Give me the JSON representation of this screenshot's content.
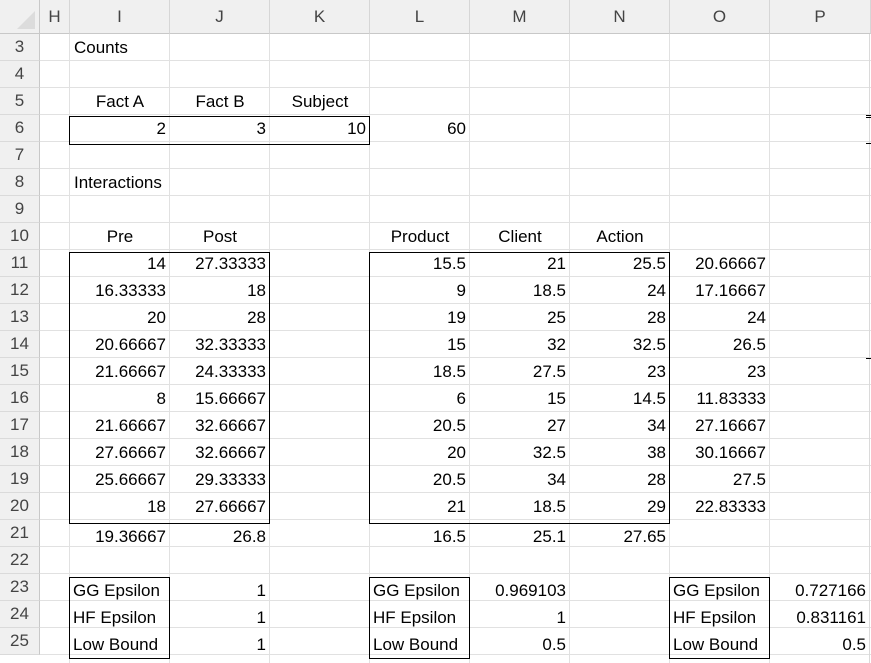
{
  "columns": [
    "H",
    "I",
    "J",
    "K",
    "L",
    "M",
    "N",
    "O",
    "P"
  ],
  "rows": [
    "3",
    "4",
    "5",
    "6",
    "7",
    "8",
    "9",
    "10",
    "11",
    "12",
    "13",
    "14",
    "15",
    "16",
    "17",
    "18",
    "19",
    "20",
    "21",
    "22",
    "23",
    "24",
    "25"
  ],
  "counts": {
    "title": "Counts",
    "headers": [
      "Fact A",
      "Fact B",
      "Subject"
    ],
    "values": [
      "2",
      "3",
      "10"
    ],
    "total": "60"
  },
  "interactions": {
    "title": "Interactions",
    "left_headers": [
      "Pre",
      "Post"
    ],
    "left_rows": [
      [
        "14",
        "27.33333"
      ],
      [
        "16.33333",
        "18"
      ],
      [
        "20",
        "28"
      ],
      [
        "20.66667",
        "32.33333"
      ],
      [
        "21.66667",
        "24.33333"
      ],
      [
        "8",
        "15.66667"
      ],
      [
        "21.66667",
        "32.66667"
      ],
      [
        "27.66667",
        "32.66667"
      ],
      [
        "25.66667",
        "29.33333"
      ],
      [
        "18",
        "27.66667"
      ]
    ],
    "left_means": [
      "19.36667",
      "26.8"
    ],
    "right_headers": [
      "Product",
      "Client",
      "Action"
    ],
    "right_rows": [
      [
        "15.5",
        "21",
        "25.5",
        "20.66667"
      ],
      [
        "9",
        "18.5",
        "24",
        "17.16667"
      ],
      [
        "19",
        "25",
        "28",
        "24"
      ],
      [
        "15",
        "32",
        "32.5",
        "26.5"
      ],
      [
        "18.5",
        "27.5",
        "23",
        "23"
      ],
      [
        "6",
        "15",
        "14.5",
        "11.83333"
      ],
      [
        "20.5",
        "27",
        "34",
        "27.16667"
      ],
      [
        "20",
        "32.5",
        "38",
        "30.16667"
      ],
      [
        "20.5",
        "34",
        "28",
        "27.5"
      ],
      [
        "21",
        "18.5",
        "29",
        "22.83333"
      ]
    ],
    "right_means": [
      "16.5",
      "25.1",
      "27.65"
    ]
  },
  "epsilon_tables": [
    {
      "labels": [
        "GG Epsilon",
        "HF Epsilon",
        "Low Bound"
      ],
      "values": [
        "1",
        "1",
        "1"
      ]
    },
    {
      "labels": [
        "GG Epsilon",
        "HF Epsilon",
        "Low Bound"
      ],
      "values": [
        "0.969103",
        "1",
        "0.5"
      ]
    },
    {
      "labels": [
        "GG Epsilon",
        "HF Epsilon",
        "Low Bound"
      ],
      "values": [
        "0.727166",
        "0.831161",
        "0.5"
      ]
    }
  ]
}
